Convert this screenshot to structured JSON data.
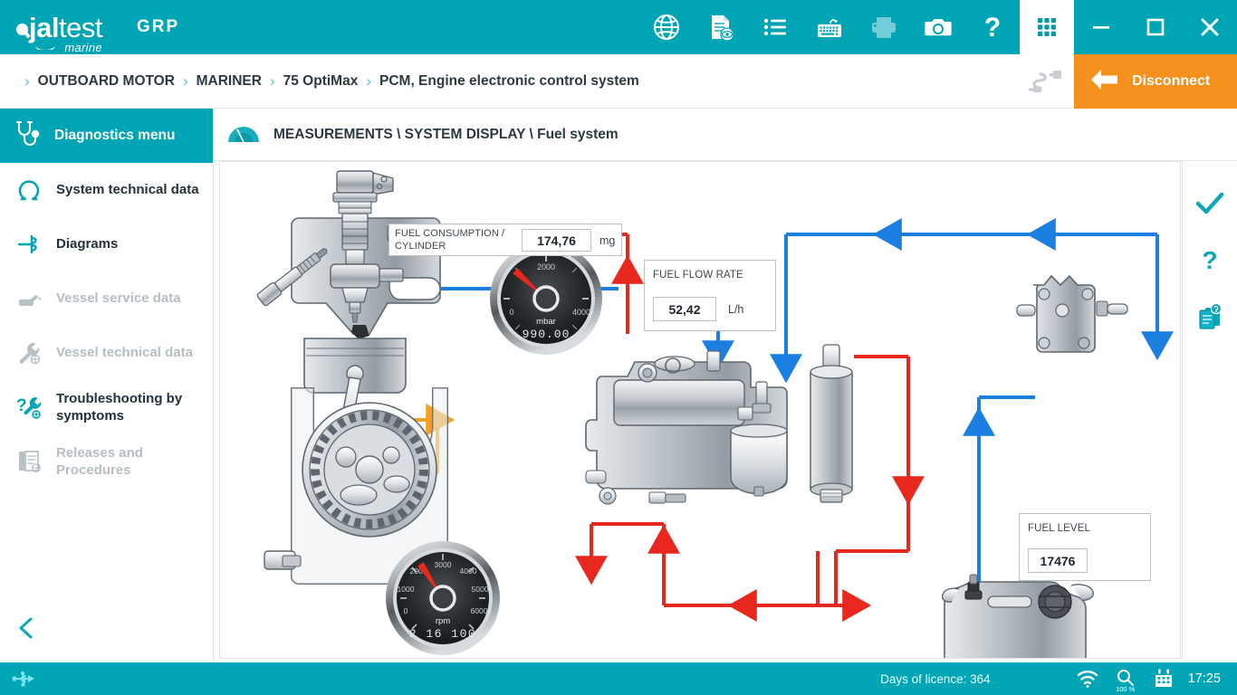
{
  "app": {
    "brand_jal": "jal",
    "brand_test": "test",
    "brand_marine": "marine",
    "product": "GRP",
    "accent": "#00a5b5",
    "accent_dark": "#009aab",
    "orange": "#f6901e"
  },
  "toolbar": {
    "icons": [
      {
        "name": "globe-icon",
        "label": "Language"
      },
      {
        "name": "document-view-icon",
        "label": "Technical documentation"
      },
      {
        "name": "list-icon",
        "label": "Menu list"
      },
      {
        "name": "keyboard-icon",
        "label": "Virtual keyboard"
      },
      {
        "name": "printer-icon",
        "label": "Print",
        "disabled": true
      },
      {
        "name": "camera-icon",
        "label": "Screenshot"
      },
      {
        "name": "help-icon",
        "label": "Help"
      },
      {
        "name": "grid-apps-icon",
        "label": "Applications",
        "active": true
      }
    ],
    "window": [
      {
        "name": "minimize-button",
        "label": "Minimize"
      },
      {
        "name": "maximize-button",
        "label": "Maximize"
      },
      {
        "name": "close-button",
        "label": "Close"
      }
    ]
  },
  "breadcrumb": {
    "items": [
      "OUTBOARD MOTOR",
      "MARINER",
      "75 OptiMax",
      "PCM, Engine electronic control system"
    ],
    "separator": "›"
  },
  "disconnect": {
    "label": "Disconnect",
    "connector_icon": "diagnostic-cable-icon"
  },
  "sidebar": {
    "header": {
      "label": "Diagnostics menu",
      "icon": "stethoscope-icon"
    },
    "items": [
      {
        "label": "System technical data",
        "icon": "omega-icon",
        "disabled": false
      },
      {
        "label": "Diagrams",
        "icon": "wiring-diagram-icon",
        "disabled": false
      },
      {
        "label": "Vessel service data",
        "icon": "oil-can-icon",
        "disabled": true
      },
      {
        "label": "Vessel technical data",
        "icon": "wrench-icon",
        "disabled": true
      },
      {
        "label": "Troubleshooting by symptoms",
        "icon": "wrench-question-icon",
        "disabled": false
      },
      {
        "label": "Releases and Procedures",
        "icon": "documents-icon",
        "disabled": true
      }
    ],
    "collapse": {
      "icon": "chevron-left-icon",
      "label": "Collapse menu"
    }
  },
  "content": {
    "header": {
      "icon": "gauge-icon",
      "title": "MEASUREMENTS \\ SYSTEM DISPLAY \\ Fuel system"
    },
    "rail": [
      {
        "name": "confirm-check-icon",
        "label": "Accept"
      },
      {
        "name": "help-question-icon",
        "label": "Help"
      },
      {
        "name": "report-document-icon",
        "label": "Report"
      }
    ]
  },
  "measurements": {
    "fuel_consumption": {
      "caption": "FUEL CONSUMPTION / CYLINDER",
      "value": "174,76",
      "unit": "mg"
    },
    "fuel_flow_rate": {
      "caption": "FUEL FLOW RATE",
      "value": "52,42",
      "unit": "L/h"
    },
    "fuel_level": {
      "caption": "FUEL LEVEL",
      "value": "17476",
      "unit": ""
    }
  },
  "gauges": [
    {
      "name": "pressure-gauge",
      "unit": "mbar",
      "digital": "990.00",
      "min": 0,
      "max": 4000,
      "value": 990,
      "ticks": [
        "0",
        "2000",
        "4000"
      ],
      "needle_color": "#e8281e"
    },
    {
      "name": "rpm-gauge",
      "unit": "rpm",
      "digital": "2 16 100",
      "min": 0,
      "max": 6000,
      "value": 2450,
      "ticks": [
        "0",
        "1000",
        "2000",
        "3000",
        "4000",
        "5000",
        "6000"
      ],
      "needle_color": "#e8281e"
    }
  ],
  "diagram": {
    "title": "Fuel system schematic",
    "components": [
      {
        "name": "fuel-injector-cylinder",
        "label": "Direct fuel injector and cylinder"
      },
      {
        "name": "vapor-separator-tank",
        "label": "Vapour separator tank / high pressure pump"
      },
      {
        "name": "fuel-filter",
        "label": "Fuel filter"
      },
      {
        "name": "low-pressure-fuel-pump",
        "label": "Low pressure fuel pump"
      },
      {
        "name": "fuel-tank",
        "label": "Fuel tank"
      }
    ],
    "flow_colors": {
      "supply": "#1a7fe0",
      "pressure": "#e8281e",
      "return": "#f2a227"
    }
  },
  "statusbar": {
    "usb_icon": "usb-icon",
    "licence": "Days of licence: 364",
    "wifi_icon": "wifi-icon",
    "zoom_icon": "zoom-icon",
    "zoom_level": "100 %",
    "calendar_icon": "calendar-icon",
    "time": "17:25"
  }
}
